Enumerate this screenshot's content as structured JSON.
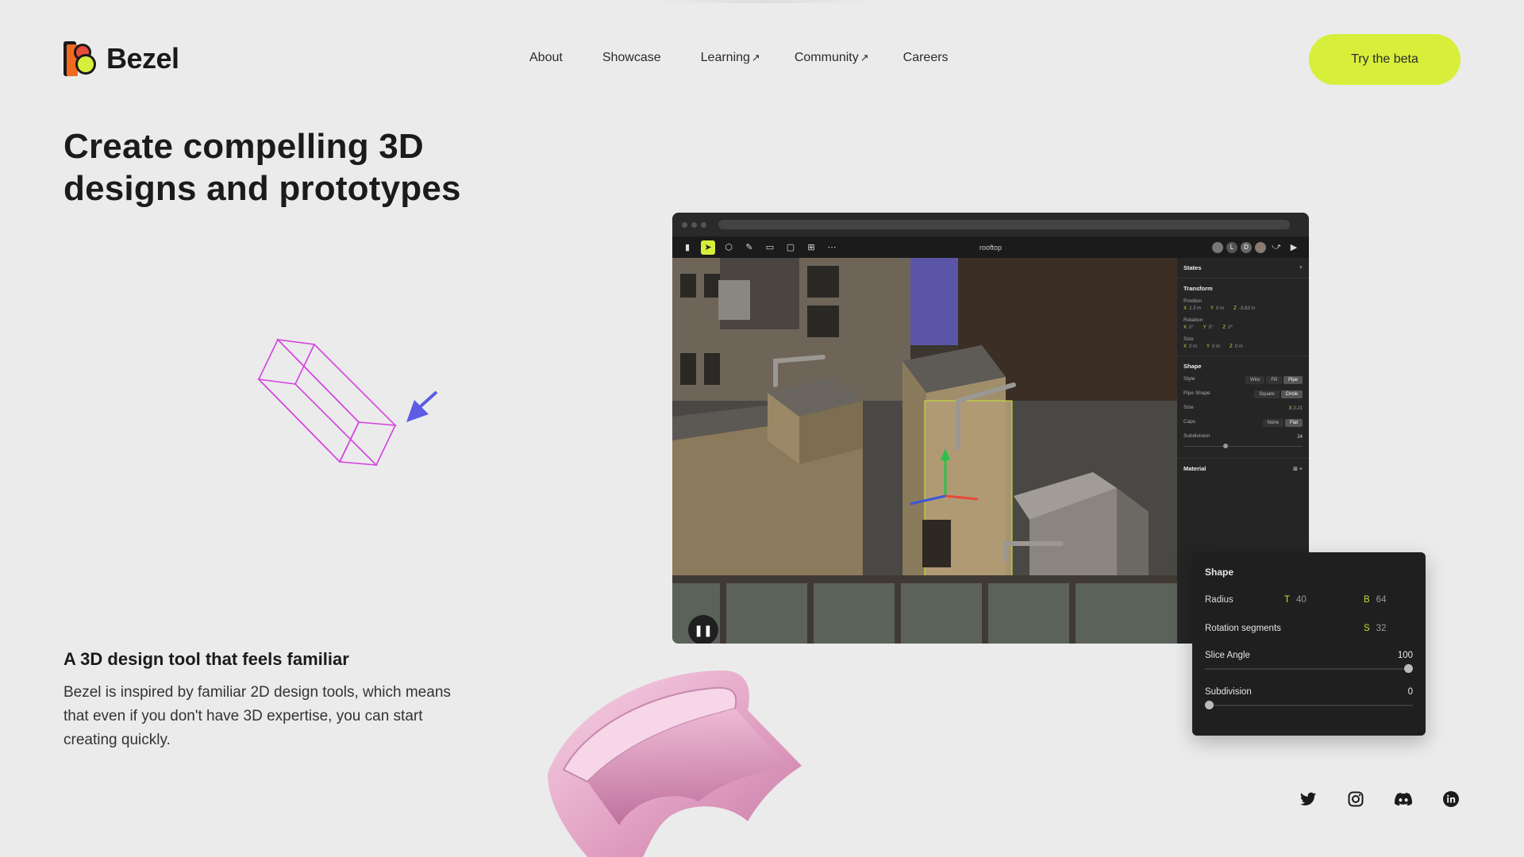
{
  "brand": {
    "name": "Bezel",
    "accent": "#d7ef3b"
  },
  "nav": {
    "items": [
      {
        "label": "About",
        "external": false
      },
      {
        "label": "Showcase",
        "external": false
      },
      {
        "label": "Learning",
        "external": true
      },
      {
        "label": "Community",
        "external": true
      },
      {
        "label": "Careers",
        "external": false
      }
    ],
    "external_arrow": "↗"
  },
  "cta": {
    "label": "Try the beta"
  },
  "hero": {
    "title": "Create compelling 3D designs and prototypes"
  },
  "feature": {
    "title": "A 3D design tool that feels familiar",
    "body": "Bezel is inspired by familiar 2D design tools, which means that even if you don't have 3D expertise, you can start creating quickly."
  },
  "app": {
    "doc_name": "rooftop",
    "avatars": [
      "L",
      "D"
    ],
    "panel": {
      "states": "States",
      "transform": "Transform",
      "position_label": "Position",
      "position": {
        "x": "1.3 m",
        "y": "0 m",
        "z": "-3.83 m"
      },
      "rotation_label": "Rotation",
      "rotation": {
        "x": "0°",
        "y": "0°",
        "z": "0°"
      },
      "size_label": "Size",
      "size": {
        "x": "0 m",
        "y": "0 m",
        "z": "0 m"
      },
      "shape": "Shape",
      "style_label": "Style",
      "style_options": [
        "Wire",
        "Fill",
        "Pipe"
      ],
      "pipe_shape_label": "Pipe Shape",
      "pipe_shape_options": [
        "Square",
        "Circle"
      ],
      "size2_label": "Size",
      "size2_value": "0.21",
      "caps_label": "Caps",
      "caps_options": [
        "None",
        "Flat"
      ],
      "subdivision_label": "Subdivision",
      "subdivision_value": "24",
      "material": "Material"
    }
  },
  "shape_card": {
    "title": "Shape",
    "radius_label": "Radius",
    "radius_t_tag": "T",
    "radius_t": "40",
    "radius_b_tag": "B",
    "radius_b": "64",
    "rotation_label": "Rotation segments",
    "rotation_tag": "S",
    "rotation_value": "32",
    "slice_label": "Slice Angle",
    "slice_value": "100",
    "slice_fraction": 1.0,
    "subdivision_label": "Subdivision",
    "subdivision_value": "0",
    "subdivision_fraction": 0.0
  },
  "socials": [
    "twitter-icon",
    "instagram-icon",
    "discord-icon",
    "linkedin-icon"
  ]
}
